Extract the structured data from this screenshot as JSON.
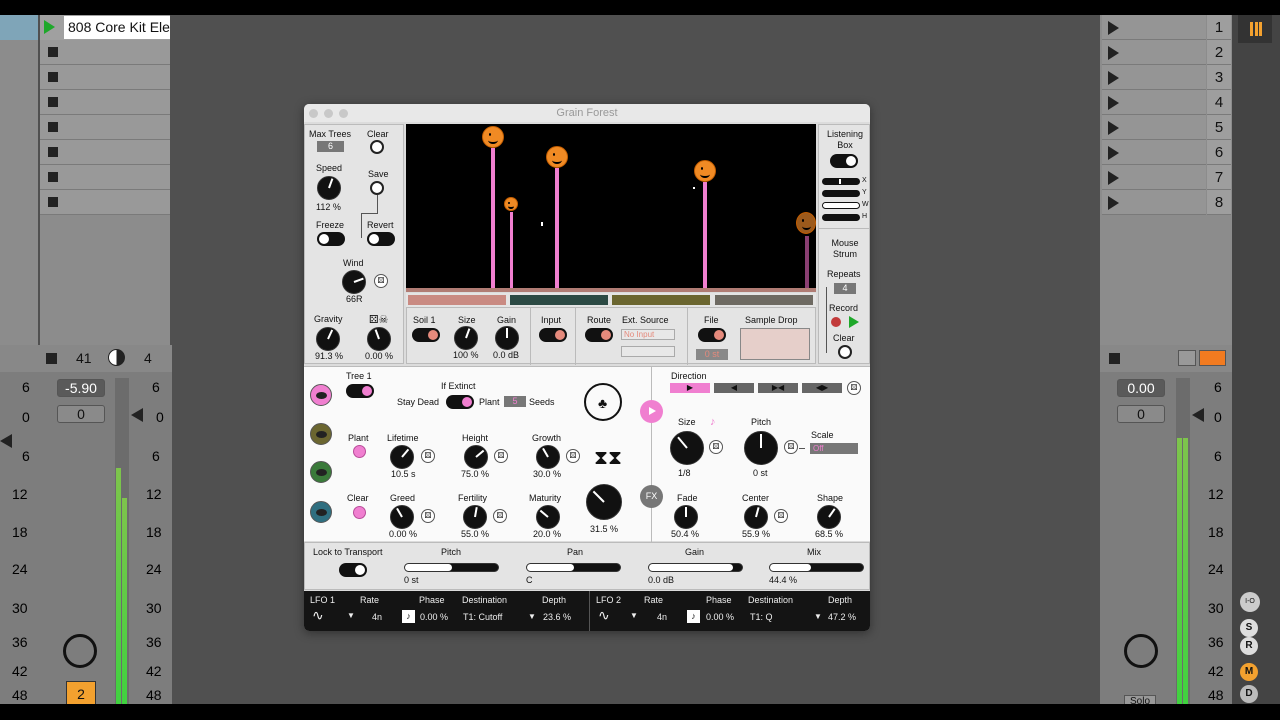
{
  "daw": {
    "track_name": "808 Core Kit Ele",
    "scene_numbers": [
      "1",
      "2",
      "3",
      "4",
      "5",
      "6",
      "7",
      "8"
    ],
    "track_volume": "-5.90",
    "track_pan": "0",
    "track_number": "41",
    "track_send": "4",
    "track_arm_number": "2",
    "master_volume": "0.00",
    "master_pan": "0",
    "db_labels": [
      "6",
      "0",
      "6",
      "12",
      "18",
      "24",
      "30",
      "36",
      "42",
      "48"
    ],
    "io_label": "I-O",
    "s_label": "S",
    "r_label": "R",
    "m_label": "M",
    "d_label": "D",
    "solo_label": "Solo"
  },
  "plugin": {
    "title": "Grain Forest",
    "left": {
      "max_trees_label": "Max Trees",
      "max_trees_value": "6",
      "clear_label": "Clear",
      "speed_label": "Speed",
      "speed_value": "112 %",
      "save_label": "Save",
      "freeze_label": "Freeze",
      "revert_label": "Revert",
      "wind_label": "Wind",
      "wind_value": "66R",
      "gravity_label": "Gravity",
      "gravity_value": "91.3 %",
      "dice_value": "0.00 %"
    },
    "soil_bars": [
      "#c98a82",
      "#2c4a44",
      "#6b6630",
      "#6e6a62"
    ],
    "bottom_row": {
      "soil_label": "Soil 1",
      "size_label": "Size",
      "size_value": "100 %",
      "gain_label": "Gain",
      "gain_value": "0.0 dB",
      "input_label": "Input",
      "route_label": "Route",
      "ext_source_label": "Ext. Source",
      "ext_source_value": "No Input",
      "file_label": "File",
      "file_value": "0 st",
      "sample_drop_label": "Sample Drop"
    },
    "right": {
      "listening_box_label": "Listening Box",
      "x_label": "X",
      "y_label": "Y",
      "w_label": "W",
      "h_label": "H",
      "mouse_strum_label": "Mouse Strum",
      "repeats_label": "Repeats",
      "repeats_value": "4",
      "record_label": "Record",
      "clear_label": "Clear"
    },
    "tree": {
      "tree_label": "Tree 1",
      "if_extinct_label": "If Extinct",
      "stay_dead_label": "Stay Dead",
      "plant_label": "Plant",
      "seeds_value": "5",
      "seeds_label": "Seeds",
      "plant_btn_label": "Plant",
      "clear_btn_label": "Clear",
      "lifetime_label": "Lifetime",
      "lifetime_value": "10.5 s",
      "height_label": "Height",
      "height_value": "75.0 %",
      "growth_label": "Growth",
      "growth_value": "30.0 %",
      "greed_label": "Greed",
      "greed_value": "0.00 %",
      "fertility_label": "Fertility",
      "fertility_value": "55.0 %",
      "maturity_label": "Maturity",
      "maturity_value": "20.0 %",
      "dna_value": "31.5 %"
    },
    "grain": {
      "direction_label": "Direction",
      "size_label": "Size",
      "size_value": "1/8",
      "pitch_label": "Pitch",
      "pitch_value": "0 st",
      "scale_label": "Scale",
      "scale_value": "Off",
      "fx_label": "FX",
      "fade_label": "Fade",
      "fade_value": "50.4 %",
      "center_label": "Center",
      "center_value": "55.9 %",
      "shape_label": "Shape",
      "shape_value": "68.5 %"
    },
    "transport": {
      "lock_label": "Lock to Transport",
      "pitch_label": "Pitch",
      "pitch_value": "0 st",
      "pan_label": "Pan",
      "pan_value": "C",
      "gain_label": "Gain",
      "gain_value": "0.0 dB",
      "mix_label": "Mix",
      "mix_value": "44.4 %",
      "pitch_level": 0.5,
      "pan_level": 0.5,
      "gain_level": 0.9,
      "mix_level": 0.44
    },
    "lfo1": {
      "name": "LFO 1",
      "rate_label": "Rate",
      "rate_value": "4n",
      "phase_label": "Phase",
      "phase_value": "0.00 %",
      "dest_label": "Destination",
      "dest_value": "T1: Cutoff",
      "depth_label": "Depth",
      "depth_value": "23.6 %"
    },
    "lfo2": {
      "name": "LFO 2",
      "rate_label": "Rate",
      "rate_value": "4n",
      "phase_label": "Phase",
      "phase_value": "0.00 %",
      "dest_label": "Destination",
      "dest_value": "T1: Q",
      "depth_label": "Depth",
      "depth_value": "47.2 %"
    },
    "colors": {
      "accent_pink": "#f07fd0",
      "smiley_orange": "#f08a24",
      "stem_pink": "#f07fd0"
    }
  }
}
